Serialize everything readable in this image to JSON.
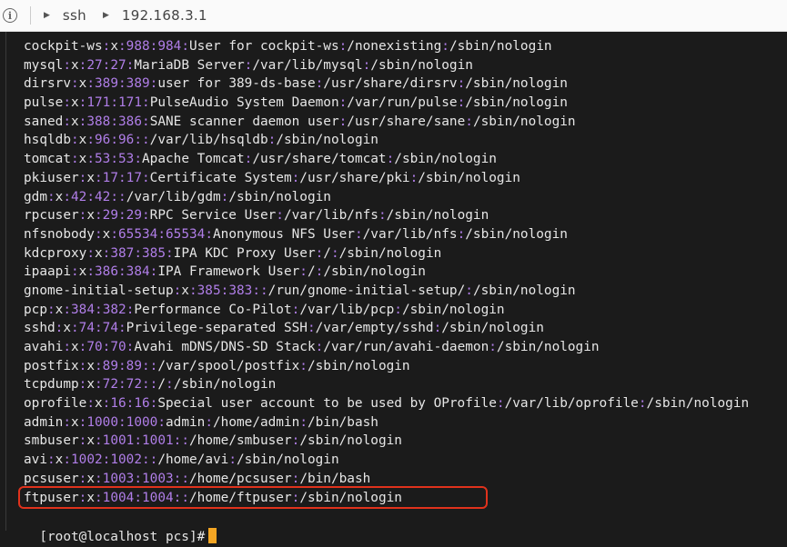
{
  "breadcrumb": {
    "items": [
      "ssh",
      "192.168.3.1"
    ]
  },
  "terminal": {
    "lines": [
      [
        "cockpit-ws",
        "988",
        "984",
        "User for cockpit-ws",
        "/nonexisting",
        "/sbin/nologin"
      ],
      [
        "mysql",
        "27",
        "27",
        "MariaDB Server",
        "/var/lib/mysql",
        "/sbin/nologin"
      ],
      [
        "dirsrv",
        "389",
        "389",
        "user for 389-ds-base",
        "/usr/share/dirsrv",
        "/sbin/nologin"
      ],
      [
        "pulse",
        "171",
        "171",
        "PulseAudio System Daemon",
        "/var/run/pulse",
        "/sbin/nologin"
      ],
      [
        "saned",
        "388",
        "386",
        "SANE scanner daemon user",
        "/usr/share/sane",
        "/sbin/nologin"
      ],
      [
        "hsqldb",
        "96",
        "96",
        "",
        "/var/lib/hsqldb",
        "/sbin/nologin"
      ],
      [
        "tomcat",
        "53",
        "53",
        "Apache Tomcat",
        "/usr/share/tomcat",
        "/sbin/nologin"
      ],
      [
        "pkiuser",
        "17",
        "17",
        "Certificate System",
        "/usr/share/pki",
        "/sbin/nologin"
      ],
      [
        "gdm",
        "42",
        "42",
        "",
        "/var/lib/gdm",
        "/sbin/nologin"
      ],
      [
        "rpcuser",
        "29",
        "29",
        "RPC Service User",
        "/var/lib/nfs",
        "/sbin/nologin"
      ],
      [
        "nfsnobody",
        "65534",
        "65534",
        "Anonymous NFS User",
        "/var/lib/nfs",
        "/sbin/nologin"
      ],
      [
        "kdcproxy",
        "387",
        "385",
        "IPA KDC Proxy User",
        "/",
        "/sbin/nologin"
      ],
      [
        "ipaapi",
        "386",
        "384",
        "IPA Framework User",
        "/",
        "/sbin/nologin"
      ],
      [
        "gnome-initial-setup",
        "385",
        "383",
        "",
        "/run/gnome-initial-setup/",
        "/sbin/nologin"
      ],
      [
        "pcp",
        "384",
        "382",
        "Performance Co-Pilot",
        "/var/lib/pcp",
        "/sbin/nologin"
      ],
      [
        "sshd",
        "74",
        "74",
        "Privilege-separated SSH",
        "/var/empty/sshd",
        "/sbin/nologin"
      ],
      [
        "avahi",
        "70",
        "70",
        "Avahi mDNS/DNS-SD Stack",
        "/var/run/avahi-daemon",
        "/sbin/nologin"
      ],
      [
        "postfix",
        "89",
        "89",
        "",
        "/var/spool/postfix",
        "/sbin/nologin"
      ],
      [
        "tcpdump",
        "72",
        "72",
        "",
        "/",
        "/sbin/nologin"
      ],
      [
        "oprofile",
        "16",
        "16",
        "Special user account to be used by OProfile",
        "/var/lib/oprofile",
        "/sbin/nologin"
      ],
      [
        "admin",
        "1000",
        "1000",
        "admin",
        "/home/admin",
        "/bin/bash"
      ],
      [
        "smbuser",
        "1001",
        "1001",
        "",
        "/home/smbuser",
        "/sbin/nologin"
      ],
      [
        "avi",
        "1002",
        "1002",
        "",
        "/home/avi",
        "/sbin/nologin"
      ],
      [
        "pcsuser",
        "1003",
        "1003",
        "",
        "/home/pcsuser",
        "/bin/bash"
      ],
      [
        "ftpuser",
        "1004",
        "1004",
        "",
        "/home/ftpuser",
        "/sbin/nologin"
      ]
    ],
    "prompt": "[root@localhost pcs]#"
  },
  "colors": {
    "background": "#1b1b1b",
    "text": "#e6e6e6",
    "number": "#b07ee8",
    "highlight": "#e0321c",
    "cursor": "#f5a623"
  }
}
